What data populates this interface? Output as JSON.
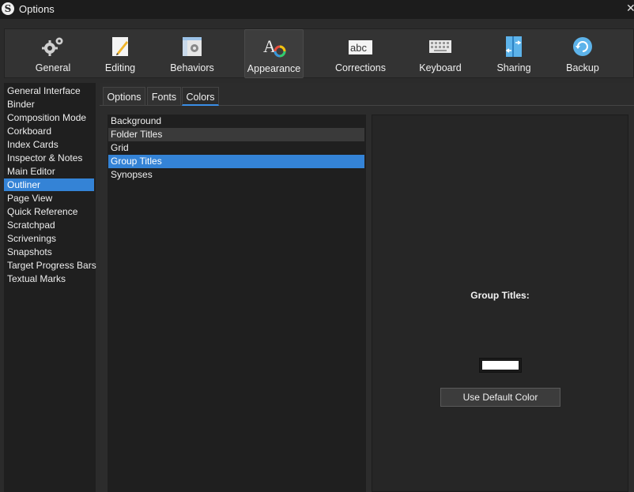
{
  "window": {
    "title": "Options",
    "app_icon": "S",
    "close_glyph": "✕"
  },
  "toolbar": {
    "items": [
      {
        "label": "General",
        "icon": "gears-icon"
      },
      {
        "label": "Editing",
        "icon": "pencil-page-icon"
      },
      {
        "label": "Behaviors",
        "icon": "window-gear-icon"
      },
      {
        "label": "Appearance",
        "icon": "appearance-icon",
        "active": true
      },
      {
        "label": "Corrections",
        "icon": "abc-icon"
      },
      {
        "label": "Keyboard",
        "icon": "keyboard-icon"
      },
      {
        "label": "Sharing",
        "icon": "sharing-icon"
      },
      {
        "label": "Backup",
        "icon": "backup-icon"
      }
    ]
  },
  "sidebar": {
    "items": [
      "General Interface",
      "Binder",
      "Composition Mode",
      "Corkboard",
      "Index Cards",
      "Inspector & Notes",
      "Main Editor",
      "Outliner",
      "Page View",
      "Quick Reference",
      "Scratchpad",
      "Scrivenings",
      "Snapshots",
      "Target Progress Bars",
      "Textual Marks"
    ],
    "selected": "Outliner"
  },
  "tabs": {
    "options": "Options",
    "fonts": "Fonts",
    "colors": "Colors",
    "active": "Colors"
  },
  "color_list": {
    "items": [
      "Background",
      "Folder Titles",
      "Grid",
      "Group Titles",
      "Synopses"
    ],
    "hovered": "Folder Titles",
    "selected": "Group Titles"
  },
  "detail": {
    "label": "Group Titles:",
    "swatch_color": "#ffffff",
    "default_button": "Use Default Color"
  },
  "colors": {
    "accent": "#3483d6",
    "tab_underline": "#3a8ee6"
  }
}
